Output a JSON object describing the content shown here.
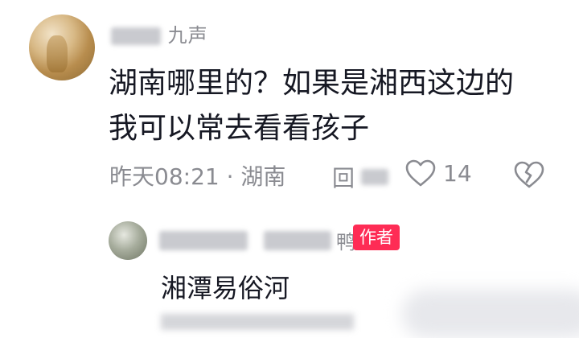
{
  "main_comment": {
    "username_suffix": "九声",
    "text_line1": "湖南哪里的？如果是湘西这边的",
    "text_line2": "我可以常去看看孩子",
    "time_location": "昨天08:21 · 湖南",
    "reply_label": "回",
    "like_count": "14",
    "icons": [
      "heart-icon",
      "broken-heart-icon"
    ]
  },
  "reply_comment": {
    "username_suffix": "鸭",
    "author_badge": "作者",
    "text": "湘潭易俗河"
  },
  "colors": {
    "text_primary": "#161823",
    "text_secondary": "#8a8b91",
    "badge_bg": "#fe2c55"
  }
}
